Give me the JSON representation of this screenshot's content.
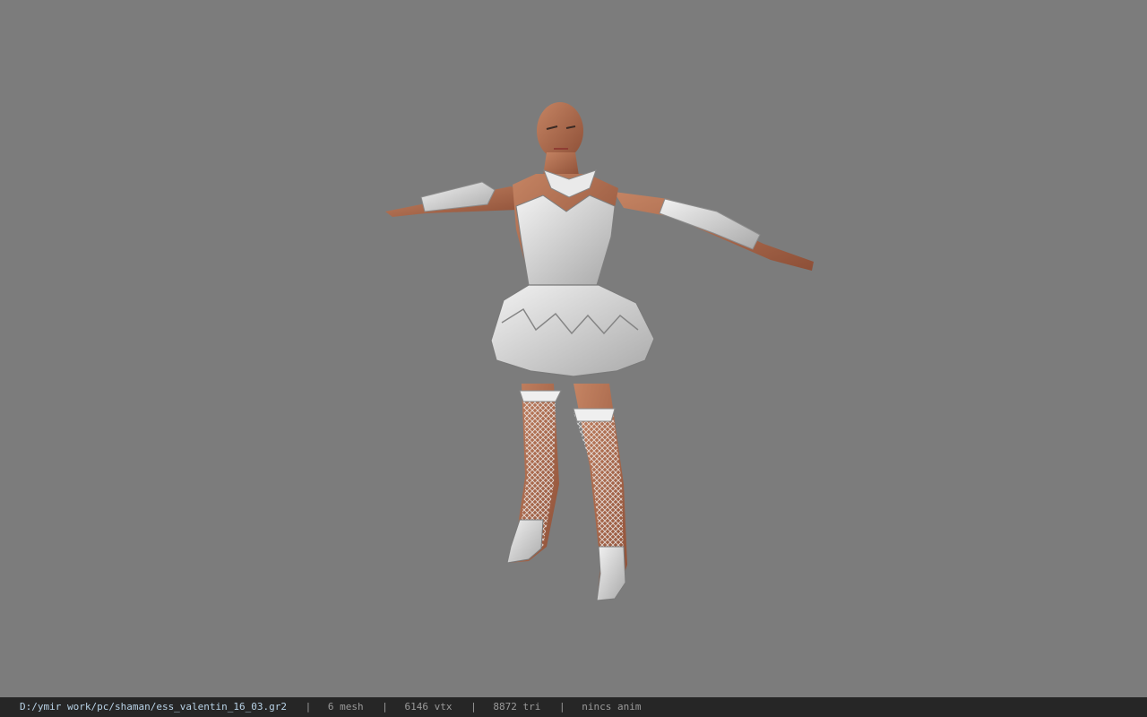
{
  "viewer": {
    "background_color": "#7c7c7c",
    "model_icon": "character-model-tpose"
  },
  "status": {
    "path": "D:/ymir work/pc/shaman/ess_valentin_16_03.gr2",
    "separator": "|",
    "mesh": "6 mesh",
    "vtx": "6146 vtx",
    "tri": "8872 tri",
    "anim": "nincs anim"
  }
}
